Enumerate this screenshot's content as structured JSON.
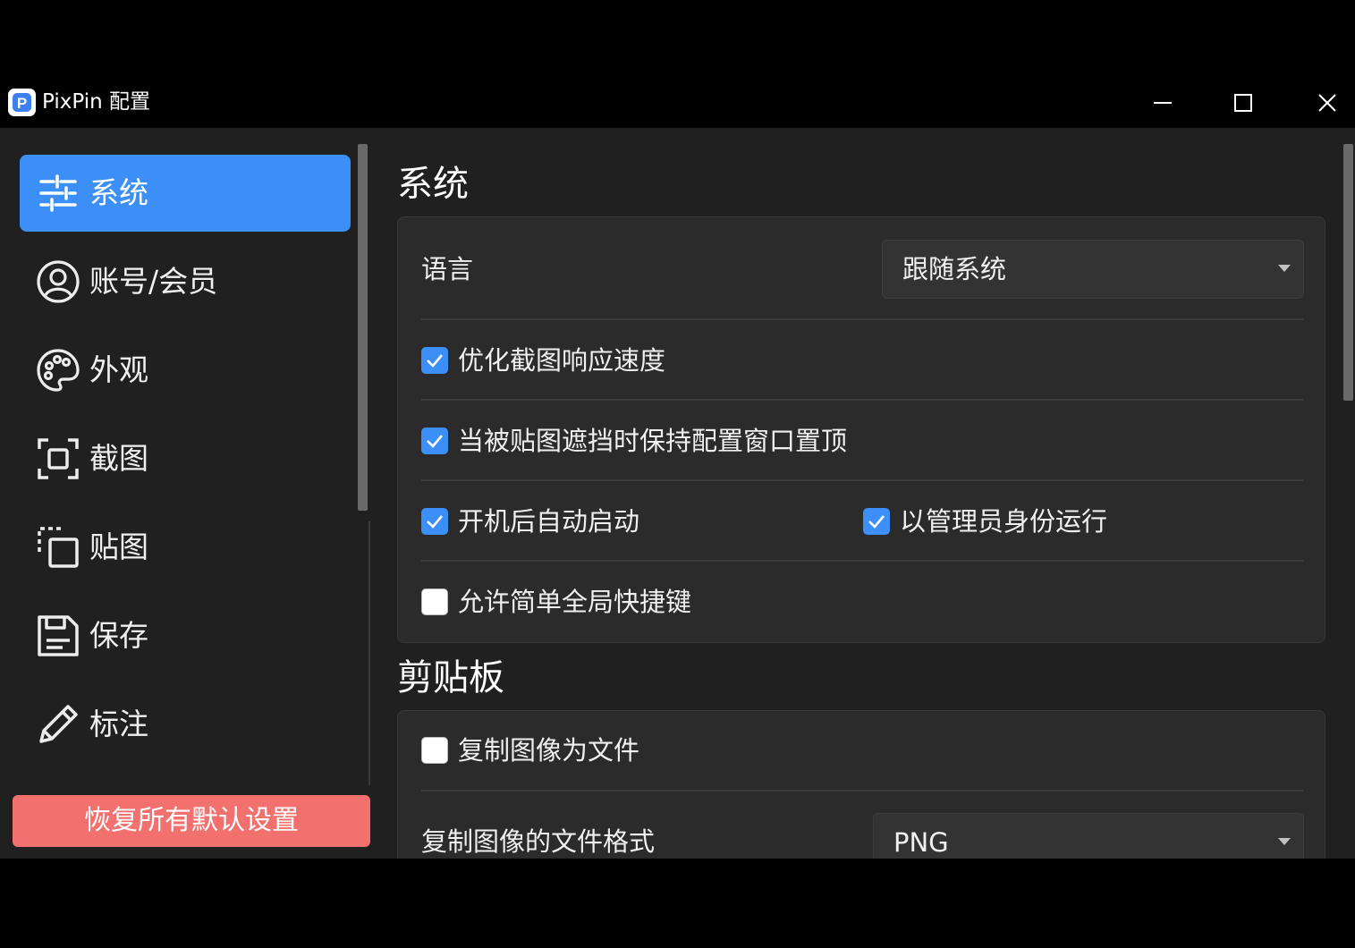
{
  "window": {
    "title": "PixPin 配置"
  },
  "sidebar": {
    "items": [
      {
        "label": "系统",
        "icon": "sliders-icon",
        "active": true
      },
      {
        "label": "账号/会员",
        "icon": "user-circle-icon",
        "active": false
      },
      {
        "label": "外观",
        "icon": "palette-icon",
        "active": false
      },
      {
        "label": "截图",
        "icon": "screenshot-frame-icon",
        "active": false
      },
      {
        "label": "贴图",
        "icon": "pin-copy-icon",
        "active": false
      },
      {
        "label": "保存",
        "icon": "save-icon",
        "active": false
      },
      {
        "label": "标注",
        "icon": "pencil-icon",
        "active": false
      }
    ],
    "reset_label": "恢复所有默认设置"
  },
  "system": {
    "title": "系统",
    "language_label": "语言",
    "language_value": "跟随系统",
    "options": [
      {
        "label": "优化截图响应速度",
        "checked": true
      },
      {
        "label": "当被贴图遮挡时保持配置窗口置顶",
        "checked": true
      },
      {
        "label": "开机后自动启动",
        "checked": true
      },
      {
        "label": "以管理员身份运行",
        "checked": true
      },
      {
        "label": "允许简单全局快捷键",
        "checked": false
      }
    ]
  },
  "clipboard": {
    "title": "剪贴板",
    "copy_as_file_label": "复制图像为文件",
    "copy_as_file_checked": false,
    "format_label": "复制图像的文件格式",
    "format_value": "PNG"
  },
  "colors": {
    "accent": "#3b8ff6",
    "danger": "#f2706e",
    "background": "#202020",
    "card": "#2b2b2b"
  }
}
